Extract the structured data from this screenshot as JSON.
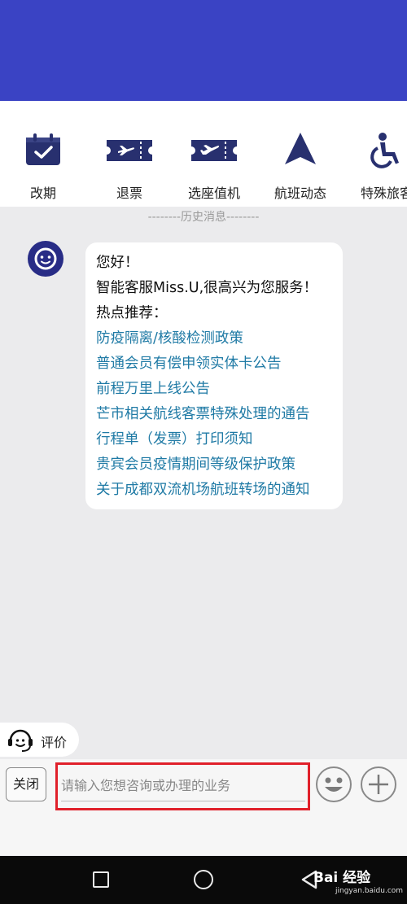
{
  "quick_actions": [
    {
      "label": "改期",
      "icon": "calendar-check-icon"
    },
    {
      "label": "退票",
      "icon": "ticket-plane-icon"
    },
    {
      "label": "选座值机",
      "icon": "ticket-plane-icon"
    },
    {
      "label": "航班动态",
      "icon": "plane-up-icon"
    },
    {
      "label": "特殊旅客",
      "icon": "wheelchair-icon"
    }
  ],
  "history_divider": "--------历史消息--------",
  "message": {
    "greeting": "您好！",
    "intro": "智能客服Miss.U,很高兴为您服务！",
    "hot_title": "热点推荐：",
    "links": [
      "防疫隔离/核酸检测政策",
      "普通会员有偿申领实体卡公告",
      "前程万里上线公告",
      "芒市相关航线客票特殊处理的通告",
      "行程单（发票）打印须知",
      "贵宾会员疫情期间等级保护政策",
      "关于成都双流机场航班转场的通知"
    ]
  },
  "rate_label": "评价",
  "input_bar": {
    "close_label": "关闭",
    "placeholder": "请输入您想咨询或办理的业务",
    "value": ""
  },
  "watermark": {
    "brand": "Bai 经验",
    "url": "jingyan.baidu.com"
  },
  "colors": {
    "header_bg": "#3a43c4",
    "icon_navy": "#28306f",
    "link_blue": "#1f7aa5",
    "highlight_red": "#e0202a",
    "background": "#ebebed"
  }
}
